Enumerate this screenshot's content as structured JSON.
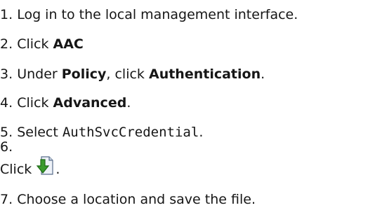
{
  "steps": [
    {
      "num": "1.",
      "text": "Log in to the local management interface."
    },
    {
      "num": "2.",
      "pre": "Click ",
      "bold": "AAC"
    },
    {
      "num": "3.",
      "pre": "Under ",
      "bold1": "Policy",
      "mid": ", click ",
      "bold2": "Authentication",
      "post": "."
    },
    {
      "num": "4.",
      "pre": "Click ",
      "bold": "Advanced",
      "post": "."
    },
    {
      "num": "5.",
      "pre": "Select ",
      "code": "AuthSvcCredential",
      "post": "."
    },
    {
      "num": "6.",
      "pre": "Click ",
      "icon": "download-file-icon",
      "post": "."
    },
    {
      "num": "7.",
      "text": "Choose a location and save the file."
    }
  ],
  "colors": {
    "text": "#161616",
    "icon_arrow": "#3a9b2c",
    "icon_page": "#e8eef6"
  }
}
